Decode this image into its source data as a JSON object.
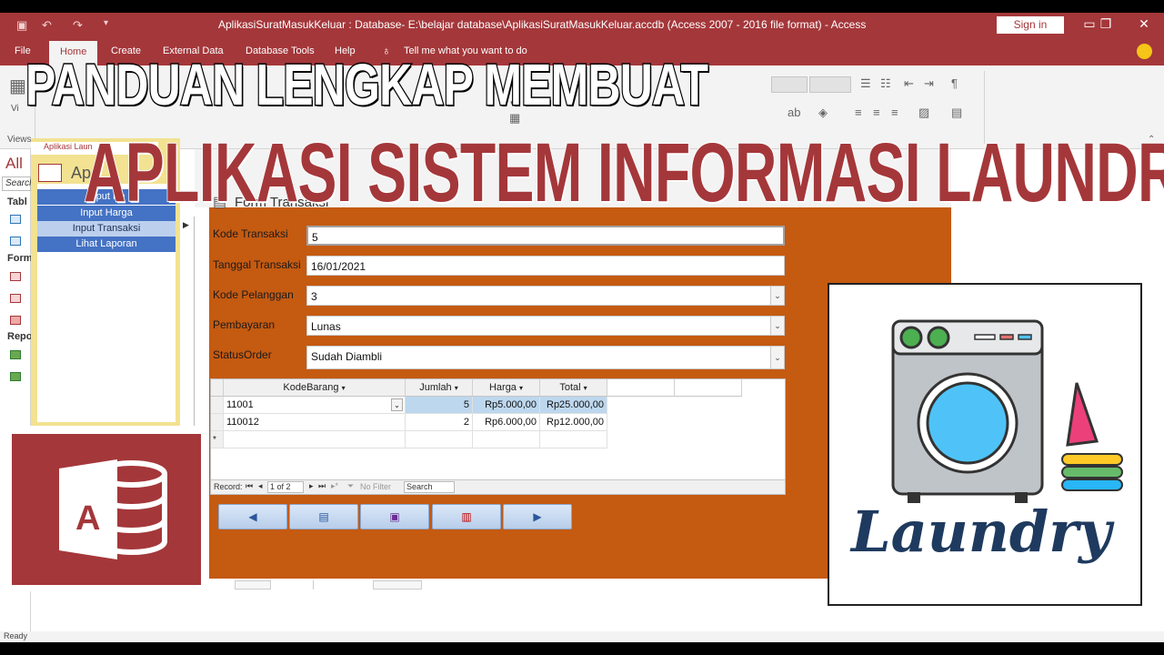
{
  "window": {
    "title": "AplikasiSuratMasukKeluar : Database- E:\\belajar database\\AplikasiSuratMasukKeluar.accdb (Access 2007 - 2016 file format)  -  Access",
    "sign_in": "Sign in"
  },
  "ribbon": {
    "tabs": [
      "File",
      "Home",
      "Create",
      "External Data",
      "Database Tools",
      "Help"
    ],
    "tell_me": "Tell me what you want to do",
    "views_label": "Views",
    "view_label": "Vi"
  },
  "nav_pane": {
    "header": "All",
    "search": "Search",
    "groups": [
      "Tabl",
      "Form",
      "Repo"
    ]
  },
  "switchboard": {
    "tab_title": "Aplikasi Laun",
    "header": "Ap",
    "items": [
      "Input Pe",
      "Input Harga",
      "Input Transaksi",
      "Lihat Laporan"
    ]
  },
  "form": {
    "heading": "Form Transaksi",
    "fields": [
      {
        "label": "Kode Transaksi",
        "value": "5",
        "dropdown": false
      },
      {
        "label": "Tanggal Transaksi",
        "value": "16/01/2021",
        "dropdown": false
      },
      {
        "label": "Kode Pelanggan",
        "value": "3",
        "dropdown": true
      },
      {
        "label": "Pembayaran",
        "value": "Lunas",
        "dropdown": true
      },
      {
        "label": "StatusOrder",
        "value": "Sudah Diambli",
        "dropdown": true
      }
    ]
  },
  "subform": {
    "columns": [
      "KodeBarang",
      "Jumlah",
      "Harga",
      "Total"
    ],
    "rows": [
      {
        "kode": "11001",
        "jumlah": "5",
        "harga": "Rp5.000,00",
        "total": "Rp25.000,00"
      },
      {
        "kode": "110012",
        "jumlah": "2",
        "harga": "Rp6.000,00",
        "total": "Rp12.000,00"
      }
    ],
    "new_row_marker": "*",
    "record_label": "Record:",
    "record_position": "1 of 2",
    "no_filter": "No Filter",
    "search": "Search"
  },
  "actions": [
    {
      "icon": "previous-record-icon",
      "glyph": "◀"
    },
    {
      "icon": "new-record-icon",
      "glyph": "▤"
    },
    {
      "icon": "save-record-icon",
      "glyph": "▣"
    },
    {
      "icon": "delete-record-icon",
      "glyph": "▥"
    },
    {
      "icon": "next-record-icon",
      "glyph": "▶"
    }
  ],
  "status_bar": {
    "text": "Ready"
  },
  "overlay": {
    "line1": "PANDUAN LENGKAP MEMBUAT",
    "line2": "APLIKASI SISTEM INFORMASI LAUNDRY",
    "laundry_word": "Laundry",
    "logo_letter": "A"
  },
  "colors": {
    "access_red": "#a4373a",
    "form_orange": "#c55a11",
    "button_blue": "#4472c4"
  }
}
